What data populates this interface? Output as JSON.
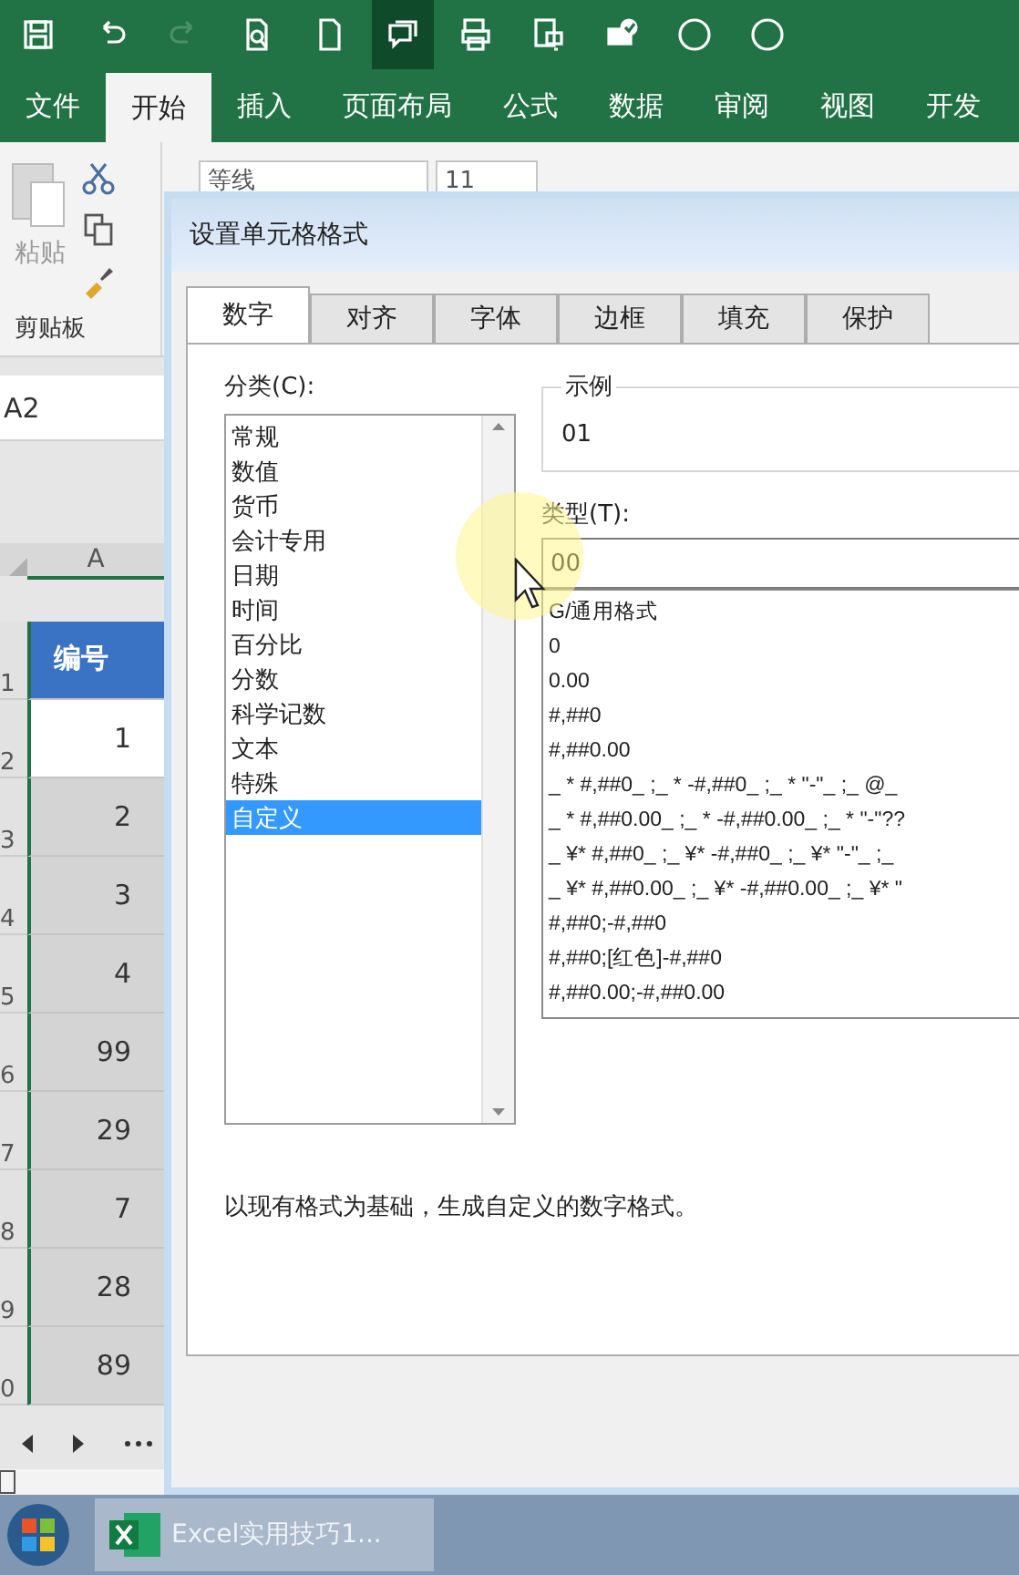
{
  "quick_access": [
    {
      "kind": "save",
      "selected": false
    },
    {
      "kind": "undo",
      "selected": false
    },
    {
      "kind": "redo",
      "selected": false
    },
    {
      "kind": "preview",
      "selected": false
    },
    {
      "kind": "new",
      "selected": false
    },
    {
      "kind": "comment",
      "selected": true
    },
    {
      "kind": "print",
      "selected": false
    },
    {
      "kind": "screen",
      "selected": false
    },
    {
      "kind": "check",
      "selected": false
    },
    {
      "kind": "circle",
      "selected": false
    },
    {
      "kind": "circle",
      "selected": false
    }
  ],
  "ribbon_tabs": [
    {
      "label": "文件",
      "selected": false
    },
    {
      "label": "开始",
      "selected": true
    },
    {
      "label": "插入",
      "selected": false
    },
    {
      "label": "页面布局",
      "selected": false
    },
    {
      "label": "公式",
      "selected": false
    },
    {
      "label": "数据",
      "selected": false
    },
    {
      "label": "审阅",
      "selected": false
    },
    {
      "label": "视图",
      "selected": false
    },
    {
      "label": "开发",
      "selected": false
    }
  ],
  "clipboard": {
    "paste": "粘贴",
    "group": "剪贴板"
  },
  "font": {
    "name": "等线",
    "size": "11"
  },
  "name_box": "A2",
  "sheet": {
    "column": "A",
    "rows": [
      {
        "number": "1",
        "value": "编号",
        "kind": "header"
      },
      {
        "number": "2",
        "value": "1",
        "kind": "cell",
        "active": true
      },
      {
        "number": "3",
        "value": "2",
        "kind": "cell",
        "active": false
      },
      {
        "number": "4",
        "value": "3",
        "kind": "cell",
        "active": false
      },
      {
        "number": "5",
        "value": "4",
        "kind": "cell",
        "active": false
      },
      {
        "number": "6",
        "value": "99",
        "kind": "cell",
        "active": false
      },
      {
        "number": "7",
        "value": "29",
        "kind": "cell",
        "active": false
      },
      {
        "number": "8",
        "value": "7",
        "kind": "cell",
        "active": false
      },
      {
        "number": "9",
        "value": "28",
        "kind": "cell",
        "active": false
      },
      {
        "number": "0",
        "value": "89",
        "kind": "cell",
        "active": false
      }
    ]
  },
  "dialog": {
    "title": "设置单元格格式",
    "tabs": [
      {
        "label": "数字",
        "selected": true
      },
      {
        "label": "对齐",
        "selected": false
      },
      {
        "label": "字体",
        "selected": false
      },
      {
        "label": "边框",
        "selected": false
      },
      {
        "label": "填充",
        "selected": false
      },
      {
        "label": "保护",
        "selected": false
      }
    ],
    "category_label": "分类(C):",
    "categories": [
      {
        "label": "常规",
        "selected": false
      },
      {
        "label": "数值",
        "selected": false
      },
      {
        "label": "货币",
        "selected": false
      },
      {
        "label": "会计专用",
        "selected": false
      },
      {
        "label": "日期",
        "selected": false
      },
      {
        "label": "时间",
        "selected": false
      },
      {
        "label": "百分比",
        "selected": false
      },
      {
        "label": "分数",
        "selected": false
      },
      {
        "label": "科学记数",
        "selected": false
      },
      {
        "label": "文本",
        "selected": false
      },
      {
        "label": "特殊",
        "selected": false
      },
      {
        "label": "自定义",
        "selected": true
      }
    ],
    "sample_label": "示例",
    "sample": "01",
    "type_label": "类型(T):",
    "type_value": "00",
    "formats": [
      "G/通用格式",
      "0",
      "0.00",
      "#,##0",
      "#,##0.00",
      "_ * #,##0_ ;_ * -#,##0_ ;_ * \"-\"_ ;_ @_",
      "_ * #,##0.00_ ;_ * -#,##0.00_ ;_ * \"-\"??",
      "_ ¥* #,##0_ ;_ ¥* -#,##0_ ;_ ¥* \"-\"_ ;_",
      "_ ¥* #,##0.00_ ;_ ¥* -#,##0.00_ ;_ ¥* \"",
      "#,##0;-#,##0",
      "#,##0;[红色]-#,##0",
      "#,##0.00;-#,##0.00"
    ],
    "description": "以现有格式为基础，生成自定义的数字格式。"
  },
  "taskbar": {
    "button": "Excel实用技巧1..."
  }
}
